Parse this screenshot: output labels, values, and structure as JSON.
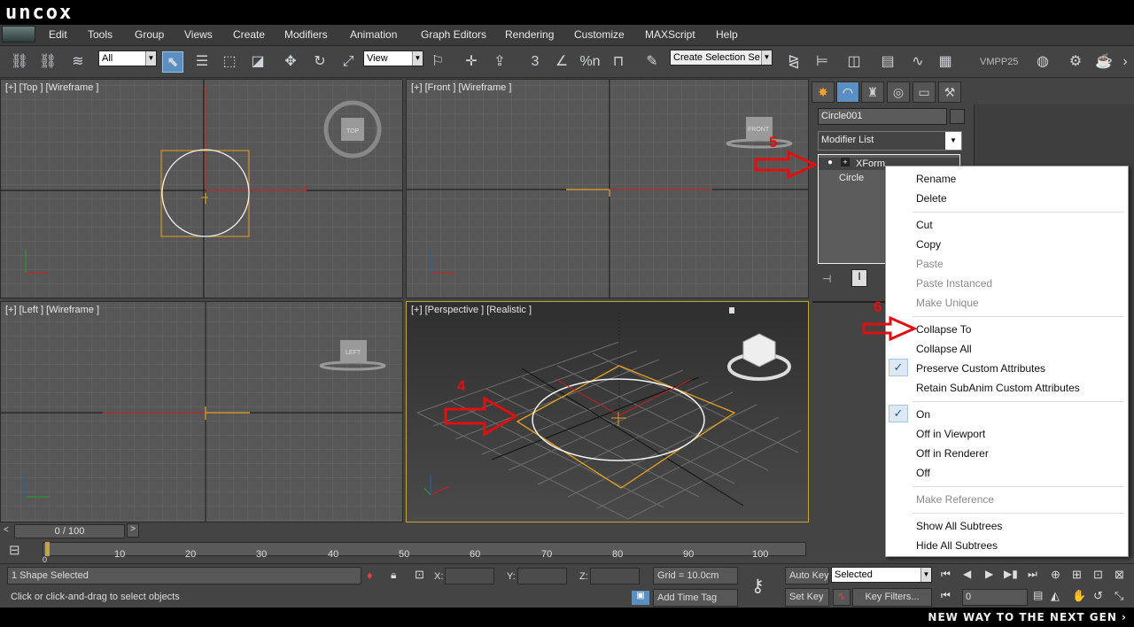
{
  "brand": {
    "logo": "uncox"
  },
  "menu": [
    "Edit",
    "Tools",
    "Group",
    "Views",
    "Create",
    "Modifiers",
    "Animation",
    "Graph Editors",
    "Rendering",
    "Customize",
    "MAXScript",
    "Help"
  ],
  "toolbar": {
    "filter": "All",
    "ref_coord": "View",
    "selection_set": "Create Selection Se",
    "render_label": "VMPP25",
    "snap_value": "3",
    "angle_snap": "%n"
  },
  "viewports": {
    "top": "[+] [Top ] [Wireframe ]",
    "front": "[+] [Front ] [Wireframe ]",
    "left": "[+] [Left ] [Wireframe ]",
    "perspective": "[+] [Perspective ] [Realistic ]",
    "cube_top": "TOP",
    "cube_front": "FRONT",
    "cube_left": "LEFT"
  },
  "command_panel": {
    "object_name": "Circle001",
    "modifier_list": "Modifier List",
    "stack": [
      "XForm",
      "Circle"
    ]
  },
  "context_menu": {
    "groups": [
      [
        {
          "label": "Rename",
          "disabled": false
        },
        {
          "label": "Delete",
          "disabled": false
        }
      ],
      [
        {
          "label": "Cut",
          "disabled": false
        },
        {
          "label": "Copy",
          "disabled": false
        },
        {
          "label": "Paste",
          "disabled": true
        },
        {
          "label": "Paste Instanced",
          "disabled": true
        },
        {
          "label": "Make Unique",
          "disabled": true
        }
      ],
      [
        {
          "label": "Collapse To",
          "disabled": false
        },
        {
          "label": "Collapse All",
          "disabled": false
        },
        {
          "label": "Preserve Custom Attributes",
          "disabled": false,
          "checked": true
        },
        {
          "label": "Retain SubAnim Custom Attributes",
          "disabled": false
        }
      ],
      [
        {
          "label": "On",
          "disabled": false,
          "checked": true
        },
        {
          "label": "Off in Viewport",
          "disabled": false
        },
        {
          "label": "Off in Renderer",
          "disabled": false
        },
        {
          "label": "Off",
          "disabled": false
        }
      ],
      [
        {
          "label": "Make Reference",
          "disabled": true
        }
      ],
      [
        {
          "label": "Show All Subtrees",
          "disabled": false
        },
        {
          "label": "Hide All Subtrees",
          "disabled": false
        }
      ]
    ]
  },
  "annotations": {
    "step4": "4",
    "step5": "5",
    "step6": "6",
    "arrow_color": "#e01010"
  },
  "timeline": {
    "frame": "0 / 100",
    "ticks": [
      "10",
      "20",
      "30",
      "40",
      "50",
      "60",
      "70",
      "80",
      "90",
      "100"
    ],
    "ticks_zero": "0"
  },
  "status": {
    "selection": "1 Shape Selected",
    "prompt": "Click or click-and-drag to select objects",
    "x_label": "X:",
    "y_label": "Y:",
    "z_label": "Z:",
    "grid": "Grid = 10.0cm",
    "add_time_tag": "Add Time Tag",
    "auto_key": "Auto Key",
    "set_key": "Set Key",
    "key_mode": "Selected",
    "key_filters": "Key Filters...",
    "current_frame": "0"
  },
  "footer": {
    "tagline": "NEW WAY TO THE NEXT GEN ›"
  },
  "colors": {
    "selection_orange": "#e8a020",
    "gizmo_red": "#c82020",
    "accent_blue": "#5b8fc2"
  }
}
